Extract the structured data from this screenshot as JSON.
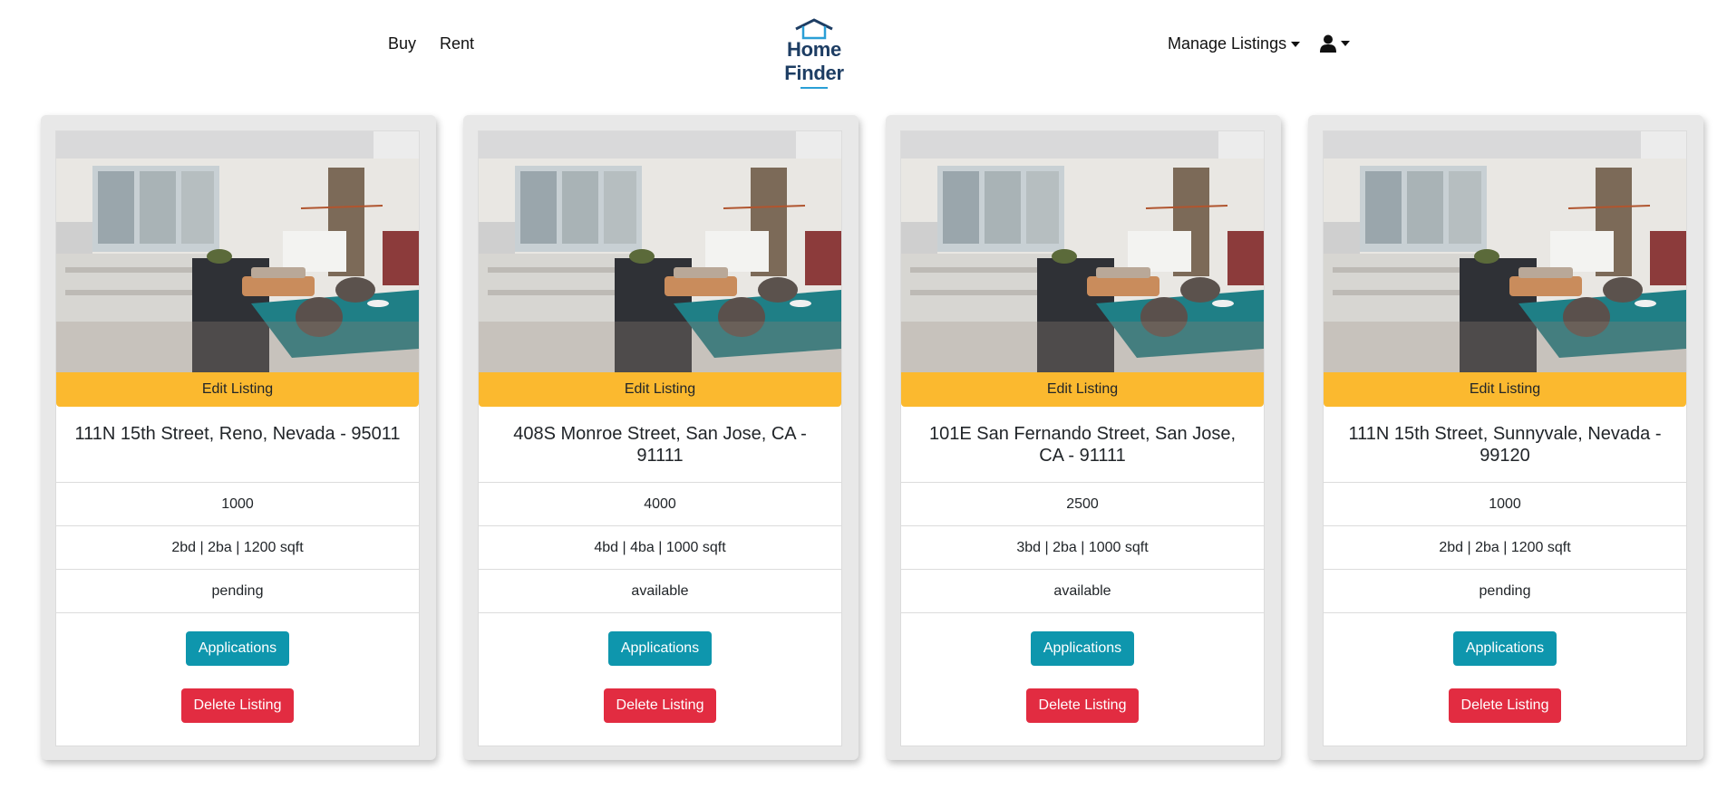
{
  "nav": {
    "buy_label": "Buy",
    "rent_label": "Rent",
    "logo_text": "Home Finder",
    "manage_label": "Manage Listings"
  },
  "colors": {
    "edit_button": "#fbb92f",
    "applications_button": "#0e96ad",
    "delete_button": "#e22c41",
    "logo_text": "#1d3d63"
  },
  "listings": [
    {
      "edit_label": "Edit Listing",
      "address": "111N 15th Street, Reno, Nevada - 95011",
      "price": "1000",
      "details": "2bd | 2ba | 1200 sqft",
      "status": "pending",
      "applications_label": "Applications",
      "delete_label": "Delete Listing"
    },
    {
      "edit_label": "Edit Listing",
      "address": "408S Monroe Street, San Jose, CA - 91111",
      "price": "4000",
      "details": "4bd | 4ba | 1000 sqft",
      "status": "available",
      "applications_label": "Applications",
      "delete_label": "Delete Listing"
    },
    {
      "edit_label": "Edit Listing",
      "address": "101E San Fernando Street, San Jose, CA - 91111",
      "price": "2500",
      "details": "3bd | 2ba | 1000 sqft",
      "status": "available",
      "applications_label": "Applications",
      "delete_label": "Delete Listing"
    },
    {
      "edit_label": "Edit Listing",
      "address": "111N 15th Street, Sunnyvale, Nevada - 99120",
      "price": "1000",
      "details": "2bd | 2ba | 1200 sqft",
      "status": "pending",
      "applications_label": "Applications",
      "delete_label": "Delete Listing"
    }
  ]
}
